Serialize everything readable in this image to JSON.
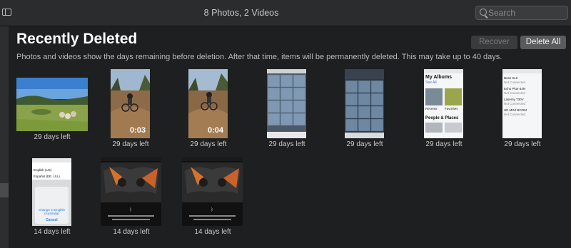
{
  "window": {
    "title": "8 Photos, 2 Videos"
  },
  "search": {
    "placeholder": "Search"
  },
  "header": {
    "title": "Recently Deleted",
    "recover_label": "Recover",
    "delete_all_label": "Delete All"
  },
  "description": "Photos and videos show the days remaining before deletion. After that time, items will be permanently deleted. This may take up to 40 days.",
  "items": [
    {
      "type": "photo",
      "subject": "landscape",
      "days_left": "29 days left"
    },
    {
      "type": "video",
      "subject": "cyclist",
      "duration": "0:03",
      "days_left": "29 days left"
    },
    {
      "type": "video",
      "subject": "cyclist",
      "duration": "0:04",
      "days_left": "29 days left"
    },
    {
      "type": "screenshot",
      "subject": "photo-grid",
      "days_left": "29 days left"
    },
    {
      "type": "screenshot",
      "subject": "photo-grid",
      "days_left": "29 days left"
    },
    {
      "type": "screenshot",
      "subject": "albums",
      "days_left": "29 days left"
    },
    {
      "type": "screenshot",
      "subject": "bluetooth",
      "days_left": "29 days left"
    },
    {
      "type": "screenshot",
      "subject": "language",
      "days_left": "14 days left"
    },
    {
      "type": "screenshot",
      "subject": "controller",
      "days_left": "14 days left"
    },
    {
      "type": "screenshot",
      "subject": "controller",
      "days_left": "14 days left"
    }
  ],
  "albums_screen": {
    "title": "My Albums",
    "see_all": "See All",
    "recents": "Recents",
    "favorites": "Favorites",
    "people_places": "People & Places"
  },
  "bluetooth_screen": {
    "devices": [
      {
        "name": "Bose SLII",
        "status": "Not Connected"
      },
      {
        "name": "Echo Plus-44N",
        "status": "Not Connected"
      },
      {
        "name": "Lasemy T30V",
        "status": "Not Connected"
      },
      {
        "name": "UE MINI BOOM",
        "status": "Not Connected"
      }
    ]
  },
  "language_screen": {
    "opt1": "English (US)",
    "opt2": "Español (EE. UU.)",
    "change_label": "Change to English (Australia)",
    "cancel": "Cancel"
  }
}
